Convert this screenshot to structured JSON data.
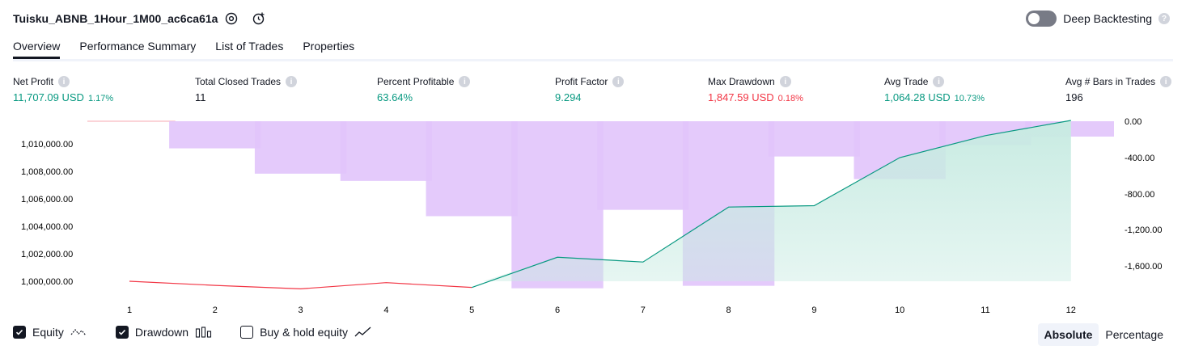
{
  "header": {
    "title": "Tuisku_ABNB_1Hour_1M00_ac6ca61a",
    "deep_backtesting_label": "Deep Backtesting",
    "help_mark": "?"
  },
  "tabs": [
    {
      "label": "Overview",
      "active": true
    },
    {
      "label": "Performance Summary",
      "active": false
    },
    {
      "label": "List of Trades",
      "active": false
    },
    {
      "label": "Properties",
      "active": false
    }
  ],
  "metrics": {
    "net_profit": {
      "label": "Net Profit",
      "value": "11,707.09 USD",
      "pct": "1.17%",
      "color": "#089981"
    },
    "total_closed_trades": {
      "label": "Total Closed Trades",
      "value": "11",
      "color": "#131722"
    },
    "percent_profitable": {
      "label": "Percent Profitable",
      "value": "63.64%",
      "color": "#089981"
    },
    "profit_factor": {
      "label": "Profit Factor",
      "value": "9.294",
      "color": "#089981"
    },
    "max_drawdown": {
      "label": "Max Drawdown",
      "value": "1,847.59 USD",
      "pct": "0.18%",
      "color": "#f23645"
    },
    "avg_trade": {
      "label": "Avg Trade",
      "value": "1,064.28 USD",
      "pct": "10.73%",
      "color": "#089981"
    },
    "avg_bars": {
      "label": "Avg # Bars in Trades",
      "value": "196",
      "color": "#131722"
    }
  },
  "chart": {
    "left_axis_labels": [
      "1,010,000.00",
      "1,008,000.00",
      "1,006,000.00",
      "1,004,000.00",
      "1,002,000.00",
      "1,000,000.00"
    ],
    "right_axis_labels": [
      "0.00",
      "-400.00",
      "-800.00",
      "-1,200.00",
      "-1,600.00"
    ],
    "x_labels": [
      "1",
      "2",
      "3",
      "4",
      "5",
      "6",
      "7",
      "8",
      "9",
      "10",
      "11",
      "12"
    ]
  },
  "chart_data": {
    "type": "line",
    "x": [
      1,
      2,
      3,
      4,
      5,
      6,
      7,
      8,
      9,
      10,
      11,
      12
    ],
    "equity": [
      1000000,
      999700,
      999450,
      999900,
      999550,
      1001750,
      1001400,
      1005400,
      1005500,
      1009000,
      1010600,
      1011707
    ],
    "drawdown": [
      0,
      -300,
      -580,
      -660,
      -1050,
      -1847.59,
      -980,
      -1820,
      -390,
      -640,
      -265,
      -170
    ],
    "left_ylim": [
      999000,
      1011707
    ],
    "right_ylim": [
      -1847.59,
      0
    ],
    "colors": {
      "equity_up": "#089981",
      "equity_down": "#f23645",
      "drawdown_bar": "#e1c4fb",
      "equity_fill": "#c8ebe2"
    },
    "grid": false
  },
  "legend": {
    "equity": {
      "label": "Equity",
      "checked": true
    },
    "drawdown": {
      "label": "Drawdown",
      "checked": true
    },
    "buy_hold": {
      "label": "Buy & hold equity",
      "checked": false
    }
  },
  "view_mode": {
    "absolute": "Absolute",
    "percentage": "Percentage",
    "selected": "Absolute"
  }
}
